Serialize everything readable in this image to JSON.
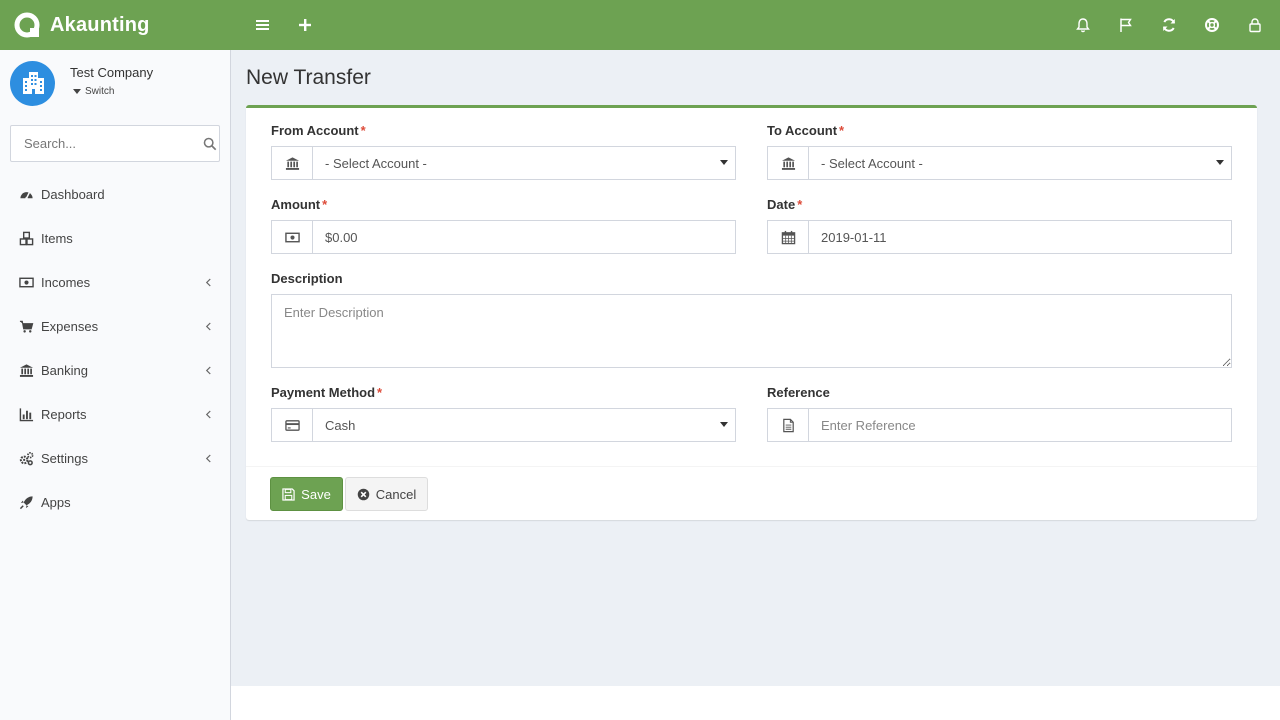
{
  "brand": {
    "name": "Akaunting"
  },
  "company": {
    "name": "Test Company",
    "switch_label": "Switch"
  },
  "search": {
    "placeholder": "Search..."
  },
  "menu": [
    {
      "label": "Dashboard",
      "icon": "dashboard-icon",
      "has_submenu": false
    },
    {
      "label": "Items",
      "icon": "cubes-icon",
      "has_submenu": false
    },
    {
      "label": "Incomes",
      "icon": "money-icon",
      "has_submenu": true
    },
    {
      "label": "Expenses",
      "icon": "cart-icon",
      "has_submenu": true
    },
    {
      "label": "Banking",
      "icon": "bank-icon",
      "has_submenu": true
    },
    {
      "label": "Reports",
      "icon": "bar-chart-icon",
      "has_submenu": true
    },
    {
      "label": "Settings",
      "icon": "gears-icon",
      "has_submenu": true
    },
    {
      "label": "Apps",
      "icon": "rocket-icon",
      "has_submenu": false
    }
  ],
  "page": {
    "title": "New Transfer"
  },
  "form": {
    "from_account": {
      "label": "From Account",
      "required_mark": "*",
      "value": "- Select Account -"
    },
    "to_account": {
      "label": "To Account",
      "required_mark": "*",
      "value": "- Select Account -"
    },
    "amount": {
      "label": "Amount",
      "required_mark": "*",
      "value": "$0.00"
    },
    "date": {
      "label": "Date",
      "required_mark": "*",
      "value": "2019-01-11"
    },
    "description": {
      "label": "Description",
      "placeholder": "Enter Description"
    },
    "payment_method": {
      "label": "Payment Method",
      "required_mark": "*",
      "value": "Cash"
    },
    "reference": {
      "label": "Reference",
      "placeholder": "Enter Reference"
    }
  },
  "buttons": {
    "save": "Save",
    "cancel": "Cancel"
  },
  "colors": {
    "brand": "#6da252",
    "sidebar_bg": "#f9fafc",
    "content_bg": "#ecf0f5",
    "required": "#dd4b39",
    "avatar": "#2d8ee0"
  }
}
